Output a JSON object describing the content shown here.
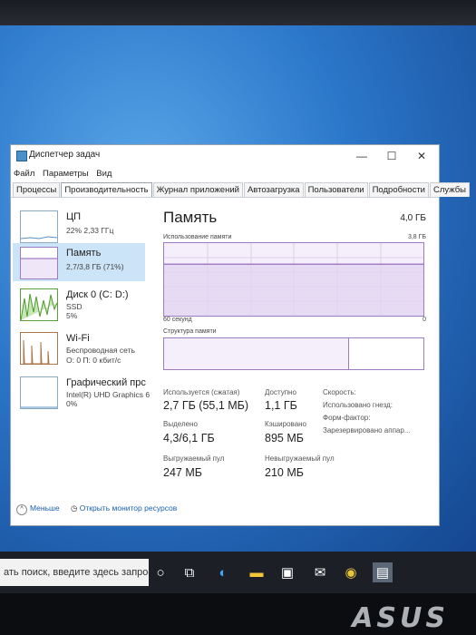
{
  "window": {
    "title": "Диспетчер задач",
    "controls": {
      "minimize": "—",
      "maximize": "☐",
      "close": "✕"
    }
  },
  "menu": [
    "Файл",
    "Параметры",
    "Вид"
  ],
  "tabs": [
    {
      "label": "Процессы",
      "active": false
    },
    {
      "label": "Производительность",
      "active": true
    },
    {
      "label": "Журнал приложений",
      "active": false
    },
    {
      "label": "Автозагрузка",
      "active": false
    },
    {
      "label": "Пользователи",
      "active": false
    },
    {
      "label": "Подробности",
      "active": false
    },
    {
      "label": "Службы",
      "active": false
    }
  ],
  "sidebar": {
    "items": [
      {
        "title": "ЦП",
        "sub1": "22% 2,33 ГГц",
        "sub2": "",
        "sub3": "",
        "selected": false
      },
      {
        "title": "Память",
        "sub1": "2,7/3,8 ГБ (71%)",
        "sub2": "",
        "sub3": "",
        "selected": true
      },
      {
        "title": "Диск 0 (C: D:)",
        "sub1": "SSD",
        "sub2": "5%",
        "sub3": "",
        "selected": false
      },
      {
        "title": "Wi-Fi",
        "sub1": "Беспроводная сеть",
        "sub2": "О: 0 П: 0 кбит/с",
        "sub3": "",
        "selected": false
      },
      {
        "title": "Графический прс",
        "sub1": "Intel(R) UHD Graphics 6",
        "sub2": "0%",
        "sub3": "",
        "selected": false
      }
    ]
  },
  "main": {
    "title": "Память",
    "total": "4,0 ГБ",
    "usage_label": "Использование памяти",
    "usage_max": "3,8 ГБ",
    "time_left": "60 секунд",
    "time_right": "0",
    "composition_label": "Структура памяти",
    "usage_fraction": 0.71,
    "stats": {
      "in_use_label": "Используется (сжатая)",
      "in_use_value": "2,7 ГБ (55,1 МБ)",
      "available_label": "Доступно",
      "available_value": "1,1 ГБ",
      "committed_label": "Выделено",
      "committed_value": "4,3/6,1 ГБ",
      "cached_label": "Кэшировано",
      "cached_value": "895 МБ",
      "paged_label": "Выгружаемый пул",
      "paged_value": "247 МБ",
      "nonpaged_label": "Невыгружаемый пул",
      "nonpaged_value": "210 МБ",
      "speed_label": "Скорость:",
      "slots_label": "Использовано гнезд:",
      "form_label": "Форм-фактор:",
      "reserved_label": "Зарезервировано аппар..."
    }
  },
  "footer": {
    "less": "Меньше",
    "monitor": "Открыть монитор ресурсов"
  },
  "taskbar": {
    "search_text": "ать поиск, введите здесь запрос",
    "icons": [
      "cortana-icon",
      "task-view-icon",
      "edge-icon",
      "file-explorer-icon",
      "store-icon",
      "mail-icon",
      "chrome-icon",
      "task-manager-icon"
    ]
  },
  "brand": "ASUS",
  "colors": {
    "memory_line": "#8b5fb8",
    "memory_fill": "#efe6f7",
    "selection": "#cce4f7"
  }
}
